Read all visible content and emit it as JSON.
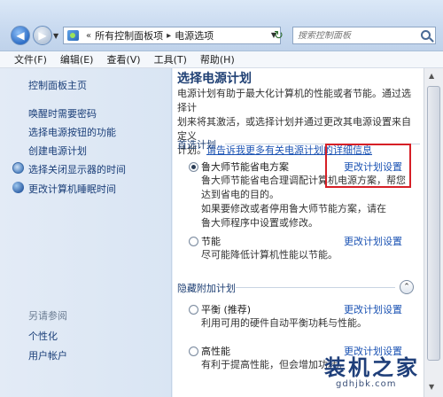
{
  "address": {
    "crumbs": [
      "所有控制面板项",
      "电源选项"
    ],
    "search_placeholder": "搜索控制面板"
  },
  "menu": [
    "文件(F)",
    "编辑(E)",
    "查看(V)",
    "工具(T)",
    "帮助(H)"
  ],
  "sidebar": {
    "links": [
      "控制面板主页",
      "唤醒时需要密码",
      "选择电源按钮的功能",
      "创建电源计划",
      "选择关闭显示器的时间",
      "更改计算机睡眠时间"
    ],
    "see_also_title": "另请参阅",
    "see_also": [
      "个性化",
      "用户帐户"
    ]
  },
  "main": {
    "title": "选择电源计划",
    "intro_line1": "电源计划有助于最大化计算机的性能或者节能。通过选择计",
    "intro_line2": "划来将其激活，或选择计划并通过更改其电源设置来自定义",
    "intro_line3_prefix": "计划。",
    "intro_link": "请告诉我更多有关电源计划的详细信息",
    "preferred_label": "首选计划",
    "hidden_label": "隐藏附加计划",
    "change_label": "更改计划设置",
    "plans": [
      {
        "name": "鲁大师节能省电方案",
        "desc": [
          "鲁大师节能省电合理调配计算机电源方案，帮您",
          "达到省电的目的。",
          "如果要修改或者停用鲁大师节能方案，请在",
          "鲁大师程序中设置或修改。"
        ],
        "selected": true
      },
      {
        "name": "节能",
        "desc": [
          "尽可能降低计算机性能以节能。"
        ],
        "selected": false
      },
      {
        "name": "平衡 (推荐)",
        "desc": [
          "利用可用的硬件自动平衡功耗与性能。"
        ],
        "selected": false
      },
      {
        "name": "高性能",
        "desc": [
          "有利于提高性能，但会增加功耗。"
        ],
        "selected": false
      }
    ]
  },
  "watermark": {
    "logo": "装机之家",
    "url": "gdhjbk.com"
  }
}
